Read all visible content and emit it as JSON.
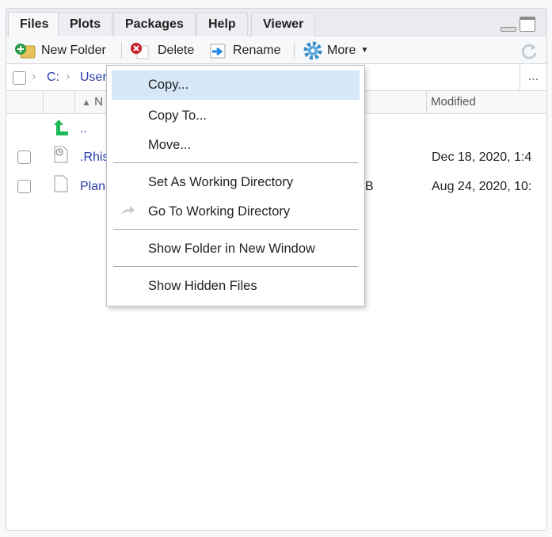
{
  "tabs": [
    "Files",
    "Plots",
    "Packages",
    "Help",
    "Viewer"
  ],
  "toolbar": {
    "new_folder": "New Folder",
    "delete": "Delete",
    "rename": "Rename",
    "more": "More"
  },
  "breadcrumb": [
    "C:",
    "User"
  ],
  "columns": {
    "name": "N",
    "modified": "Modified"
  },
  "files": [
    {
      "name": "..",
      "icon": "up-arrow-icon"
    },
    {
      "name": ".Rhis",
      "size": "",
      "modified": "Dec 18, 2020, 1:4"
    },
    {
      "name": "Plan",
      "size": "B",
      "modified": "Aug 24, 2020, 10:"
    }
  ],
  "menu": {
    "items": [
      "Copy...",
      "Copy To...",
      "Move...",
      "Set As Working Directory",
      "Go To Working Directory",
      "Show Folder in New Window",
      "Show Hidden Files"
    ]
  },
  "ellipsis": "...",
  "colors": {
    "highlight": "#d6e7f7",
    "link": "#2a3fa8"
  }
}
